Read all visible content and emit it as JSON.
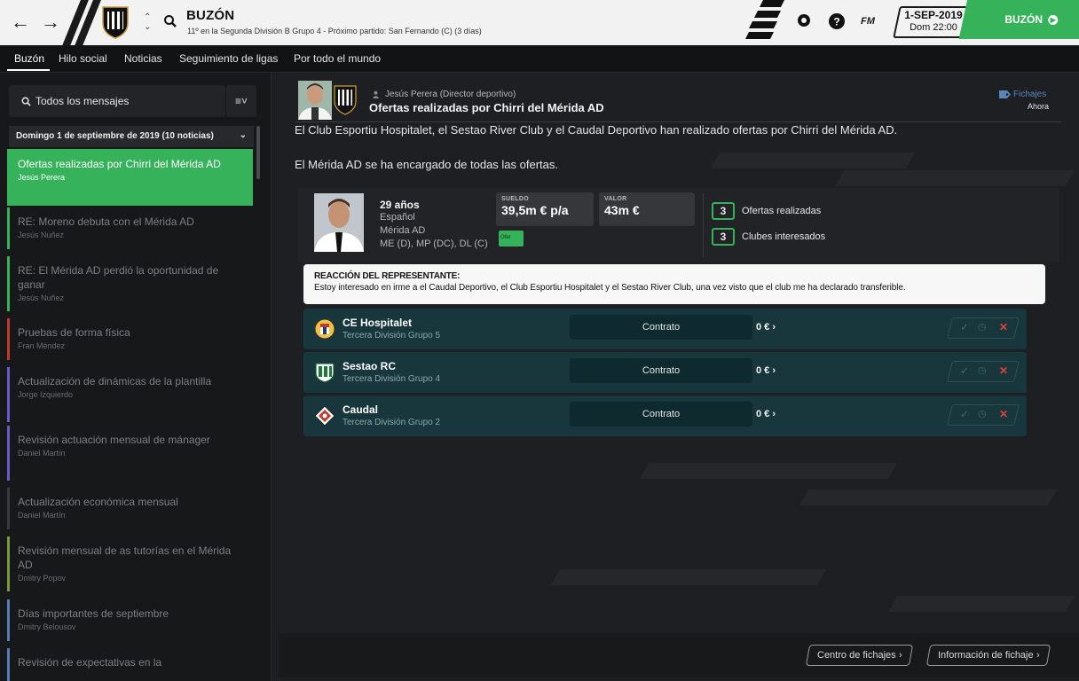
{
  "topbar": {
    "title": "BUZÓN",
    "subtitle": "11º en la Segunda División B Grupo 4 - Próximo partido: San Fernando (C)  (3 días)",
    "fm_label": "FM",
    "date_main": "1-SEP-2019",
    "date_sub": "Dom 22:00",
    "continue_label": "BUZÓN",
    "icons": [
      "back-arrow-icon",
      "forward-arrow-icon",
      "club-crest-icon",
      "search-icon",
      "ball-icon",
      "help-icon"
    ]
  },
  "tabs": [
    {
      "label": "Buzón"
    },
    {
      "label": "Hilo social"
    },
    {
      "label": "Noticias"
    },
    {
      "label": "Seguimiento de ligas"
    },
    {
      "label": "Por todo el mundo"
    }
  ],
  "sidebar": {
    "search_label": "Todos los mensajes",
    "day_header": "Domingo 1 de septiembre de 2019 (10 noticias)",
    "messages": [
      {
        "title": "Ofertas realizadas por Chirri del Mérida AD",
        "sender": "Jesús Perera",
        "color": "#36b35a"
      },
      {
        "title": "RE: Moreno debuta con el Mérida AD",
        "sender": "Jesús Nuñez",
        "color": "#36b35a"
      },
      {
        "title": "RE: El Mérida AD perdió la oportunidad de ganar",
        "sender": "Jesús Nuñez",
        "color": "#36b35a"
      },
      {
        "title": "Pruebas de forma física",
        "sender": "Fran Méndez",
        "color": "#c0392b"
      },
      {
        "title": "Actualización de dinámicas de la plantilla",
        "sender": "Jorge Izquierdo",
        "color": "#6a5acd"
      },
      {
        "title": "Revisión actuación mensual de mánager",
        "sender": "Daniel Martín",
        "color": "#6a5acd"
      },
      {
        "title": "Actualización económica mensual",
        "sender": "Daniel Martín",
        "color": "#3a3b3e"
      },
      {
        "title": "Revisión mensual de as tutorías en el Mérida AD",
        "sender": "Dmitry Popov",
        "color": "#7a9a3a"
      },
      {
        "title": "Días importantes de septiembre",
        "sender": "Dmitry Belousov",
        "color": "#5a7ab8"
      },
      {
        "title": "Revisión de expectativas en la",
        "sender": "",
        "color": "#5a7ab8"
      }
    ]
  },
  "message": {
    "sender": "Jesús Perera  (Director deportivo)",
    "subject": "Ofertas realizadas por Chirri del Mérida AD",
    "category": "Fichajes",
    "time": "Ahora",
    "body_1": "El Club Esportiu Hospitalet, el Sestao River Club y el Caudal Deportivo han realizado ofertas por Chirri del Mérida AD.",
    "body_2": "El Mérida AD se ha encargado de todas las ofertas."
  },
  "player": {
    "age": "29 años",
    "nationality": "Español",
    "club": "Mérida AD",
    "positions": "ME (D), MP (DC), DL (C)",
    "wage_label": "SUELDO",
    "wage": "39,5m € p/a",
    "value_label": "VALOR",
    "value": "43m €",
    "offer_tag": "Ofer",
    "offers_count": "3",
    "offers_label": "Ofertas realizadas",
    "clubs_count": "3",
    "clubs_label": "Clubes interesados"
  },
  "agent": {
    "heading": "REACCIÓN DEL REPRESENTANTE:",
    "text": "Estoy interesado en irme a el Caudal Deportivo, el Club Esportiu Hospitalet y el Sestao River Club, una vez visto que el club me ha declarado transferible."
  },
  "offers": [
    {
      "club": "CE Hospitalet",
      "division": "Tercera División Grupo 5",
      "contract_label": "Contrato",
      "fee": "0 €"
    },
    {
      "club": "Sestao RC",
      "division": "Tercera División Grupo 4",
      "contract_label": "Contrato",
      "fee": "0 €"
    },
    {
      "club": "Caudal",
      "division": "Tercera División Grupo 2",
      "contract_label": "Contrato",
      "fee": "0 €"
    }
  ],
  "footer": {
    "transfer_centre": "Centro de fichajes",
    "transfer_info": "Información de fichaje"
  },
  "colors": {
    "accent_green": "#36b35a",
    "offer_row": "#17373c",
    "reject_red": "#e0413c"
  }
}
